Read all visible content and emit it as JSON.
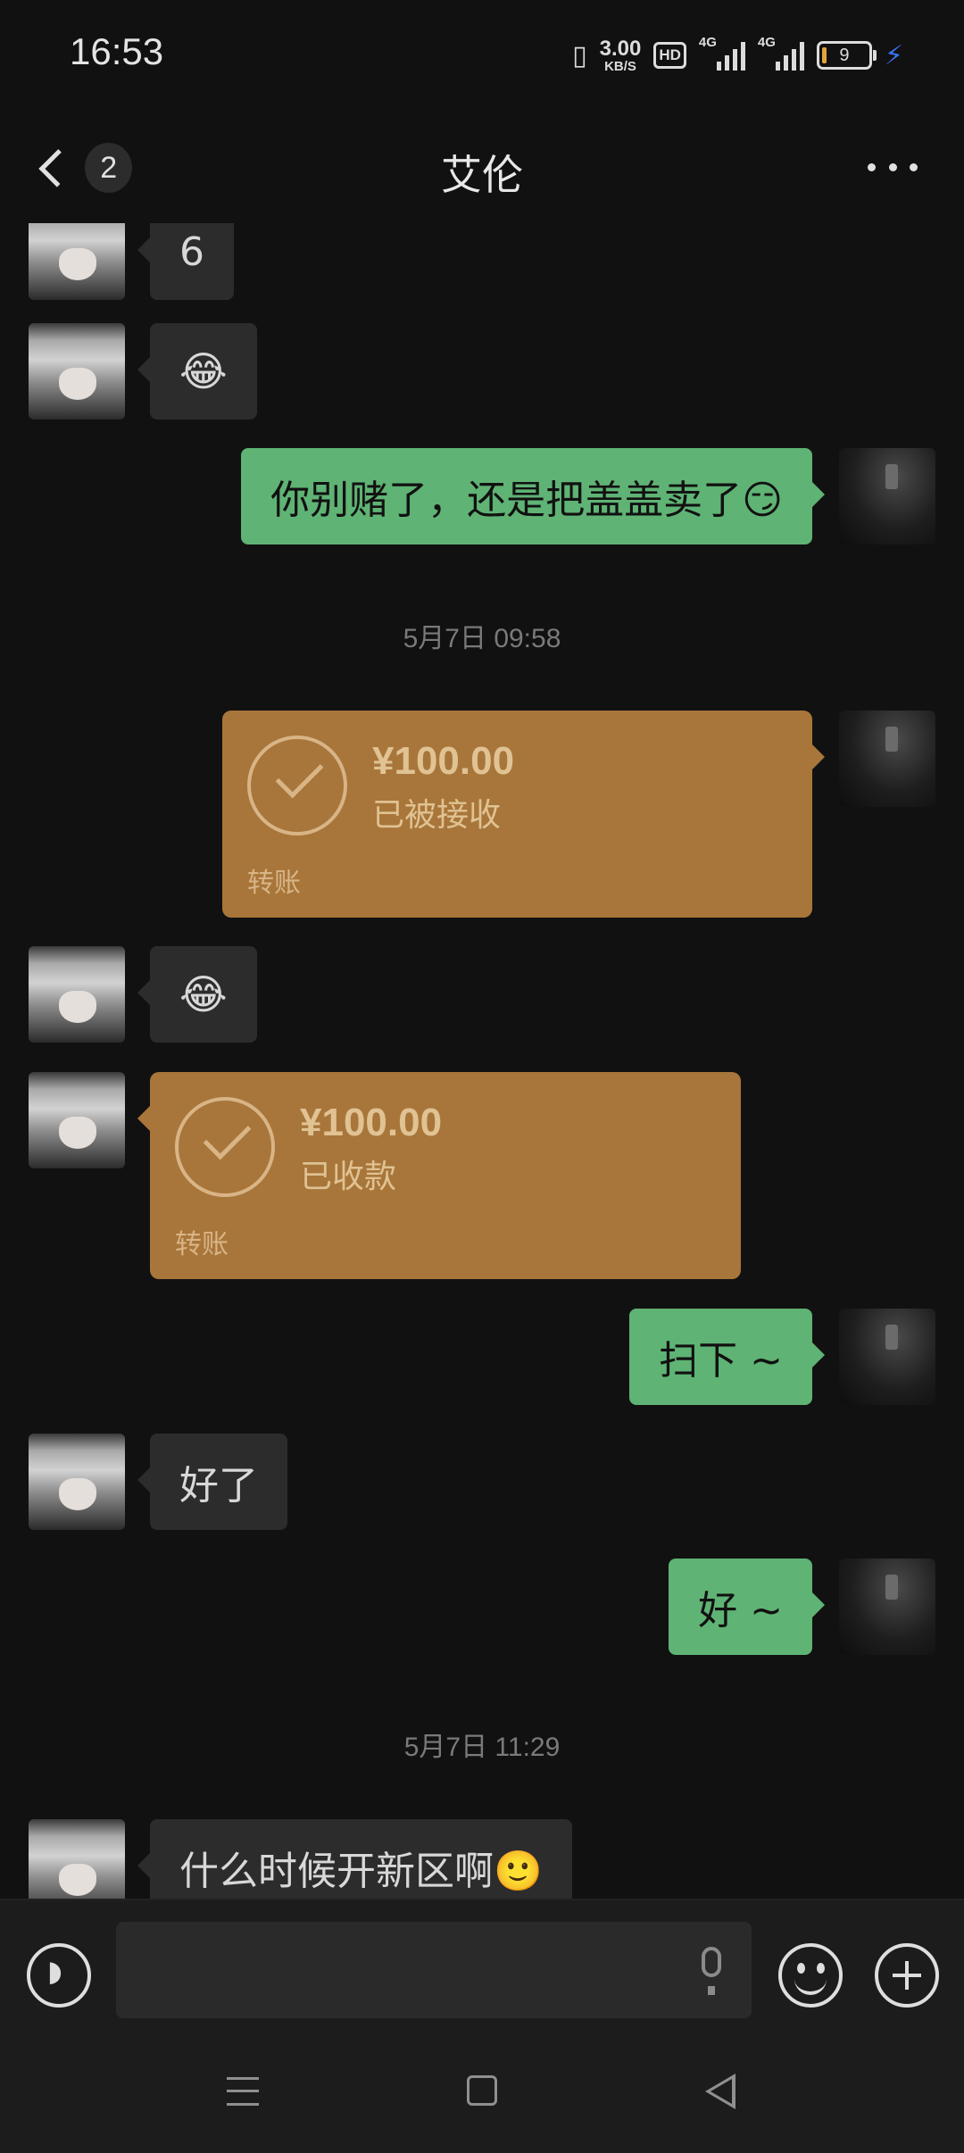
{
  "status_bar": {
    "time": "16:53",
    "net_speed_value": "3.00",
    "net_speed_unit": "KB/S",
    "hd_label": "HD",
    "signal1_label": "4G",
    "signal2_label": "4G",
    "battery_level": "9",
    "icons": [
      "vibrate-icon",
      "hd-icon",
      "signal-icon",
      "signal-icon",
      "battery-icon",
      "charging-icon"
    ]
  },
  "header": {
    "title": "艾伦",
    "unread_count": "2"
  },
  "messages": [
    {
      "from": "friend",
      "text": "6"
    },
    {
      "from": "friend",
      "text": "😂"
    },
    {
      "from": "me",
      "text": "你别赌了，还是把盖盖卖了😏"
    },
    {
      "timestamp": "5月7日 09:58"
    },
    {
      "from": "me",
      "type": "transfer",
      "amount": "¥100.00",
      "status": "已被接收",
      "label": "转账"
    },
    {
      "from": "friend",
      "text": "😂"
    },
    {
      "from": "friend",
      "type": "transfer",
      "amount": "¥100.00",
      "status": "已收款",
      "label": "转账"
    },
    {
      "from": "me",
      "text": "扫下 ~"
    },
    {
      "from": "friend",
      "text": "好了"
    },
    {
      "from": "me",
      "text": "好 ~"
    },
    {
      "timestamp": "5月7日 11:29"
    },
    {
      "from": "friend",
      "text": "什么时候开新区啊🙂"
    }
  ],
  "colors": {
    "background": "#111111",
    "outgoing_bubble": "#5fb374",
    "incoming_bubble": "#2c2c2c",
    "transfer_card": "#a8763a"
  }
}
